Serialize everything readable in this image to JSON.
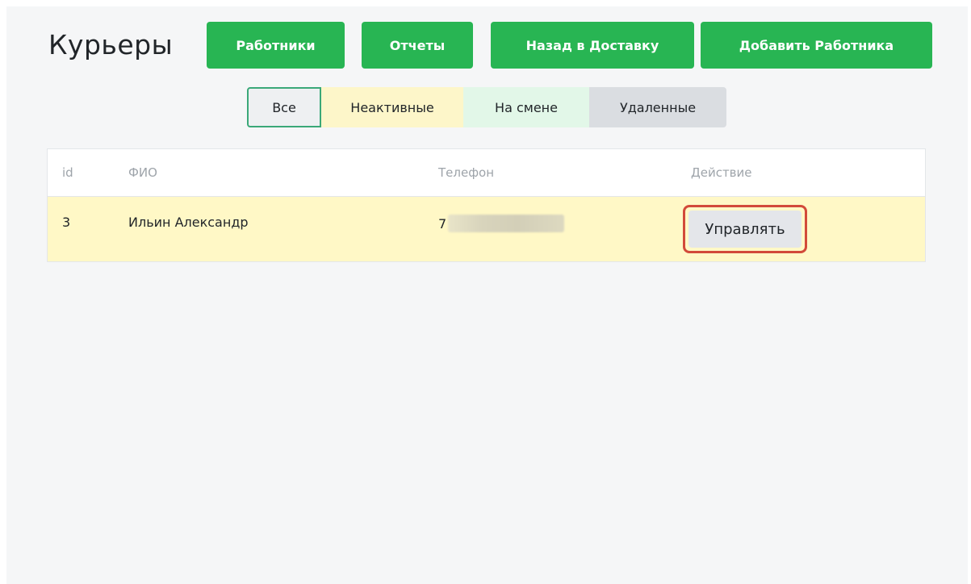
{
  "page": {
    "title": "Курьеры"
  },
  "nav": {
    "workers": "Работники",
    "reports": "Отчеты",
    "back_to_delivery": "Назад в Доставку",
    "add_worker": "Добавить Работника"
  },
  "filters": {
    "all": "Все",
    "inactive": "Неактивные",
    "on_shift": "На смене",
    "deleted": "Удаленные",
    "selected": "Все"
  },
  "table": {
    "headers": [
      "id",
      "ФИО",
      "Телефон",
      "Действие"
    ],
    "rows": [
      {
        "id": "3",
        "name": "Ильин Александр",
        "phone_prefix": "7",
        "action": "Управлять"
      }
    ]
  },
  "colors": {
    "accent_green": "#28b553",
    "row_highlight": "#fff8c6",
    "annotation_red": "#d24a3a"
  }
}
